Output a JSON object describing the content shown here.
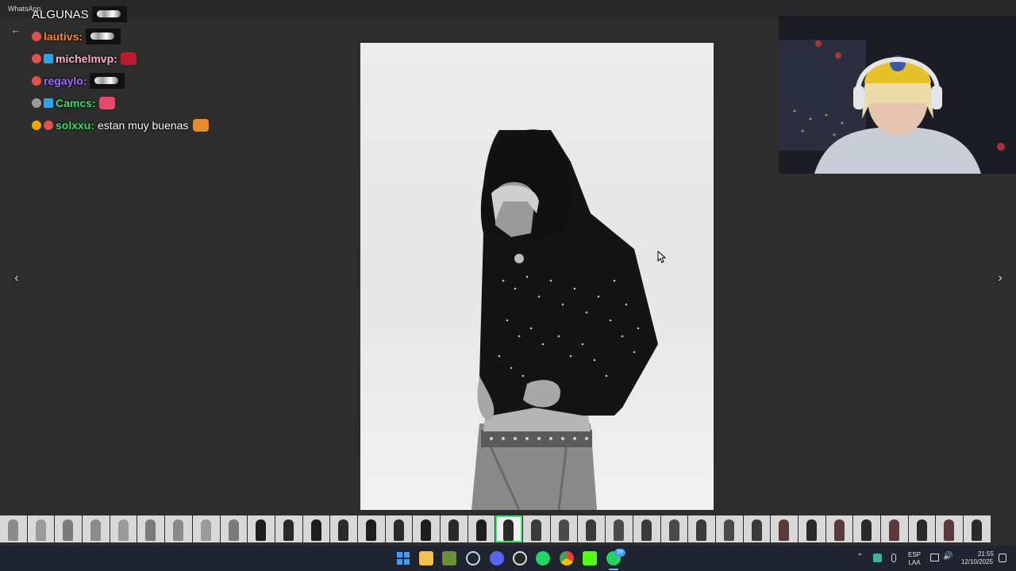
{
  "window": {
    "title": "WhatsApp"
  },
  "chat": {
    "lines": [
      {
        "user": "ALGUNAS",
        "color": "#ffffff",
        "message": ""
      },
      {
        "user": "lautivs:",
        "color": "#ff8c1a",
        "message": ""
      },
      {
        "user": "michelmvp:",
        "color": "#ffb3c8",
        "message": ""
      },
      {
        "user": "regaylo:",
        "color": "#a46bff",
        "message": ""
      },
      {
        "user": "Camcs:",
        "color": "#33e06b",
        "message": ""
      },
      {
        "user": "solxxu:",
        "color": "#33e06b",
        "message": "estan muy buenas"
      }
    ]
  },
  "viewer": {
    "prev_icon": "chevron-left-icon",
    "next_icon": "chevron-right-icon",
    "back_icon": "arrow-left-icon"
  },
  "tray": {
    "lang_top": "ESP",
    "lang_bottom": "LAA",
    "time": "21:55",
    "date": "12/10/2025",
    "whatsapp_badge": "59"
  },
  "colors": {
    "accent_active_thumb": "#3fe06f",
    "background": "#2d2d2d",
    "taskbar": "#1f2430"
  }
}
